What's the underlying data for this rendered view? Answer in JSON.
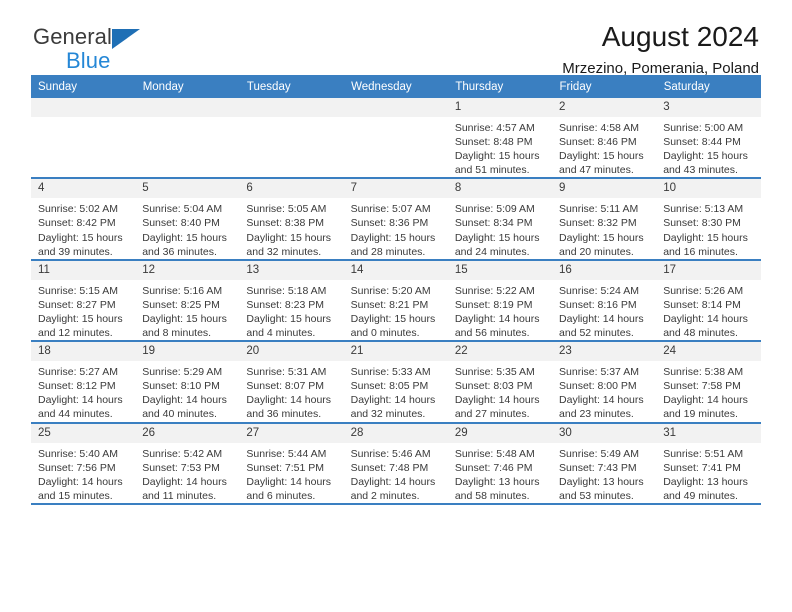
{
  "brand": {
    "name_top": "General",
    "name_bottom": "Blue",
    "triangle_color": "#1f6fb5",
    "blue_color": "#2587d6"
  },
  "header": {
    "title": "August 2024",
    "location": "Mrzezino, Pomerania, Poland"
  },
  "theme": {
    "header_bg": "#3a7fc1",
    "daynum_bg": "#f2f2f2",
    "text": "#3a3a3a"
  },
  "weekday_headers": [
    "Sunday",
    "Monday",
    "Tuesday",
    "Wednesday",
    "Thursday",
    "Friday",
    "Saturday"
  ],
  "weeks": [
    [
      {
        "day": "",
        "empty": true,
        "sunrise": "",
        "sunset": "",
        "daylight_line1": "",
        "daylight_line2": ""
      },
      {
        "day": "",
        "empty": true,
        "sunrise": "",
        "sunset": "",
        "daylight_line1": "",
        "daylight_line2": ""
      },
      {
        "day": "",
        "empty": true,
        "sunrise": "",
        "sunset": "",
        "daylight_line1": "",
        "daylight_line2": ""
      },
      {
        "day": "",
        "empty": true,
        "sunrise": "",
        "sunset": "",
        "daylight_line1": "",
        "daylight_line2": ""
      },
      {
        "day": "1",
        "empty": false,
        "sunrise": "Sunrise: 4:57 AM",
        "sunset": "Sunset: 8:48 PM",
        "daylight_line1": "Daylight: 15 hours",
        "daylight_line2": "and 51 minutes."
      },
      {
        "day": "2",
        "empty": false,
        "sunrise": "Sunrise: 4:58 AM",
        "sunset": "Sunset: 8:46 PM",
        "daylight_line1": "Daylight: 15 hours",
        "daylight_line2": "and 47 minutes."
      },
      {
        "day": "3",
        "empty": false,
        "sunrise": "Sunrise: 5:00 AM",
        "sunset": "Sunset: 8:44 PM",
        "daylight_line1": "Daylight: 15 hours",
        "daylight_line2": "and 43 minutes."
      }
    ],
    [
      {
        "day": "4",
        "empty": false,
        "sunrise": "Sunrise: 5:02 AM",
        "sunset": "Sunset: 8:42 PM",
        "daylight_line1": "Daylight: 15 hours",
        "daylight_line2": "and 39 minutes."
      },
      {
        "day": "5",
        "empty": false,
        "sunrise": "Sunrise: 5:04 AM",
        "sunset": "Sunset: 8:40 PM",
        "daylight_line1": "Daylight: 15 hours",
        "daylight_line2": "and 36 minutes."
      },
      {
        "day": "6",
        "empty": false,
        "sunrise": "Sunrise: 5:05 AM",
        "sunset": "Sunset: 8:38 PM",
        "daylight_line1": "Daylight: 15 hours",
        "daylight_line2": "and 32 minutes."
      },
      {
        "day": "7",
        "empty": false,
        "sunrise": "Sunrise: 5:07 AM",
        "sunset": "Sunset: 8:36 PM",
        "daylight_line1": "Daylight: 15 hours",
        "daylight_line2": "and 28 minutes."
      },
      {
        "day": "8",
        "empty": false,
        "sunrise": "Sunrise: 5:09 AM",
        "sunset": "Sunset: 8:34 PM",
        "daylight_line1": "Daylight: 15 hours",
        "daylight_line2": "and 24 minutes."
      },
      {
        "day": "9",
        "empty": false,
        "sunrise": "Sunrise: 5:11 AM",
        "sunset": "Sunset: 8:32 PM",
        "daylight_line1": "Daylight: 15 hours",
        "daylight_line2": "and 20 minutes."
      },
      {
        "day": "10",
        "empty": false,
        "sunrise": "Sunrise: 5:13 AM",
        "sunset": "Sunset: 8:30 PM",
        "daylight_line1": "Daylight: 15 hours",
        "daylight_line2": "and 16 minutes."
      }
    ],
    [
      {
        "day": "11",
        "empty": false,
        "sunrise": "Sunrise: 5:15 AM",
        "sunset": "Sunset: 8:27 PM",
        "daylight_line1": "Daylight: 15 hours",
        "daylight_line2": "and 12 minutes."
      },
      {
        "day": "12",
        "empty": false,
        "sunrise": "Sunrise: 5:16 AM",
        "sunset": "Sunset: 8:25 PM",
        "daylight_line1": "Daylight: 15 hours",
        "daylight_line2": "and 8 minutes."
      },
      {
        "day": "13",
        "empty": false,
        "sunrise": "Sunrise: 5:18 AM",
        "sunset": "Sunset: 8:23 PM",
        "daylight_line1": "Daylight: 15 hours",
        "daylight_line2": "and 4 minutes."
      },
      {
        "day": "14",
        "empty": false,
        "sunrise": "Sunrise: 5:20 AM",
        "sunset": "Sunset: 8:21 PM",
        "daylight_line1": "Daylight: 15 hours",
        "daylight_line2": "and 0 minutes."
      },
      {
        "day": "15",
        "empty": false,
        "sunrise": "Sunrise: 5:22 AM",
        "sunset": "Sunset: 8:19 PM",
        "daylight_line1": "Daylight: 14 hours",
        "daylight_line2": "and 56 minutes."
      },
      {
        "day": "16",
        "empty": false,
        "sunrise": "Sunrise: 5:24 AM",
        "sunset": "Sunset: 8:16 PM",
        "daylight_line1": "Daylight: 14 hours",
        "daylight_line2": "and 52 minutes."
      },
      {
        "day": "17",
        "empty": false,
        "sunrise": "Sunrise: 5:26 AM",
        "sunset": "Sunset: 8:14 PM",
        "daylight_line1": "Daylight: 14 hours",
        "daylight_line2": "and 48 minutes."
      }
    ],
    [
      {
        "day": "18",
        "empty": false,
        "sunrise": "Sunrise: 5:27 AM",
        "sunset": "Sunset: 8:12 PM",
        "daylight_line1": "Daylight: 14 hours",
        "daylight_line2": "and 44 minutes."
      },
      {
        "day": "19",
        "empty": false,
        "sunrise": "Sunrise: 5:29 AM",
        "sunset": "Sunset: 8:10 PM",
        "daylight_line1": "Daylight: 14 hours",
        "daylight_line2": "and 40 minutes."
      },
      {
        "day": "20",
        "empty": false,
        "sunrise": "Sunrise: 5:31 AM",
        "sunset": "Sunset: 8:07 PM",
        "daylight_line1": "Daylight: 14 hours",
        "daylight_line2": "and 36 minutes."
      },
      {
        "day": "21",
        "empty": false,
        "sunrise": "Sunrise: 5:33 AM",
        "sunset": "Sunset: 8:05 PM",
        "daylight_line1": "Daylight: 14 hours",
        "daylight_line2": "and 32 minutes."
      },
      {
        "day": "22",
        "empty": false,
        "sunrise": "Sunrise: 5:35 AM",
        "sunset": "Sunset: 8:03 PM",
        "daylight_line1": "Daylight: 14 hours",
        "daylight_line2": "and 27 minutes."
      },
      {
        "day": "23",
        "empty": false,
        "sunrise": "Sunrise: 5:37 AM",
        "sunset": "Sunset: 8:00 PM",
        "daylight_line1": "Daylight: 14 hours",
        "daylight_line2": "and 23 minutes."
      },
      {
        "day": "24",
        "empty": false,
        "sunrise": "Sunrise: 5:38 AM",
        "sunset": "Sunset: 7:58 PM",
        "daylight_line1": "Daylight: 14 hours",
        "daylight_line2": "and 19 minutes."
      }
    ],
    [
      {
        "day": "25",
        "empty": false,
        "sunrise": "Sunrise: 5:40 AM",
        "sunset": "Sunset: 7:56 PM",
        "daylight_line1": "Daylight: 14 hours",
        "daylight_line2": "and 15 minutes."
      },
      {
        "day": "26",
        "empty": false,
        "sunrise": "Sunrise: 5:42 AM",
        "sunset": "Sunset: 7:53 PM",
        "daylight_line1": "Daylight: 14 hours",
        "daylight_line2": "and 11 minutes."
      },
      {
        "day": "27",
        "empty": false,
        "sunrise": "Sunrise: 5:44 AM",
        "sunset": "Sunset: 7:51 PM",
        "daylight_line1": "Daylight: 14 hours",
        "daylight_line2": "and 6 minutes."
      },
      {
        "day": "28",
        "empty": false,
        "sunrise": "Sunrise: 5:46 AM",
        "sunset": "Sunset: 7:48 PM",
        "daylight_line1": "Daylight: 14 hours",
        "daylight_line2": "and 2 minutes."
      },
      {
        "day": "29",
        "empty": false,
        "sunrise": "Sunrise: 5:48 AM",
        "sunset": "Sunset: 7:46 PM",
        "daylight_line1": "Daylight: 13 hours",
        "daylight_line2": "and 58 minutes."
      },
      {
        "day": "30",
        "empty": false,
        "sunrise": "Sunrise: 5:49 AM",
        "sunset": "Sunset: 7:43 PM",
        "daylight_line1": "Daylight: 13 hours",
        "daylight_line2": "and 53 minutes."
      },
      {
        "day": "31",
        "empty": false,
        "sunrise": "Sunrise: 5:51 AM",
        "sunset": "Sunset: 7:41 PM",
        "daylight_line1": "Daylight: 13 hours",
        "daylight_line2": "and 49 minutes."
      }
    ]
  ]
}
